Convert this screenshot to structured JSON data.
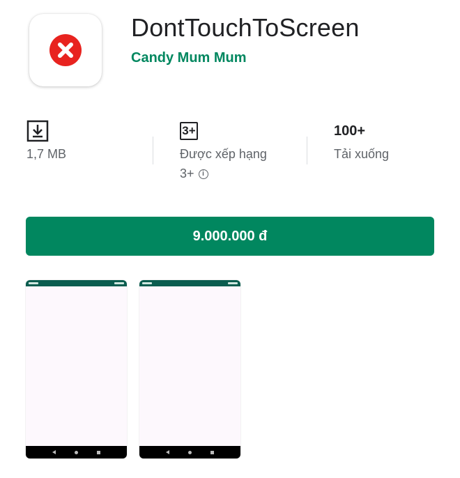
{
  "app": {
    "title": "DontTouchToScreen",
    "developer": "Candy Mum Mum",
    "icon": "red-x-circle-icon"
  },
  "stats": {
    "size": {
      "icon": "download-icon",
      "label": "1,7 MB"
    },
    "rating": {
      "badge": "3+",
      "label_line1": "Được xếp hạng",
      "label_line2": "3+",
      "info_icon": "info-icon"
    },
    "downloads": {
      "value": "100+",
      "label": "Tải xuống"
    }
  },
  "buy_button": {
    "label": "9.000.000 đ"
  },
  "screenshots": [
    {
      "name": "screenshot-1"
    },
    {
      "name": "screenshot-2"
    }
  ],
  "colors": {
    "accent": "#01875f",
    "icon_red": "#e8231f",
    "text_primary": "#202124",
    "text_secondary": "#5f6368"
  }
}
